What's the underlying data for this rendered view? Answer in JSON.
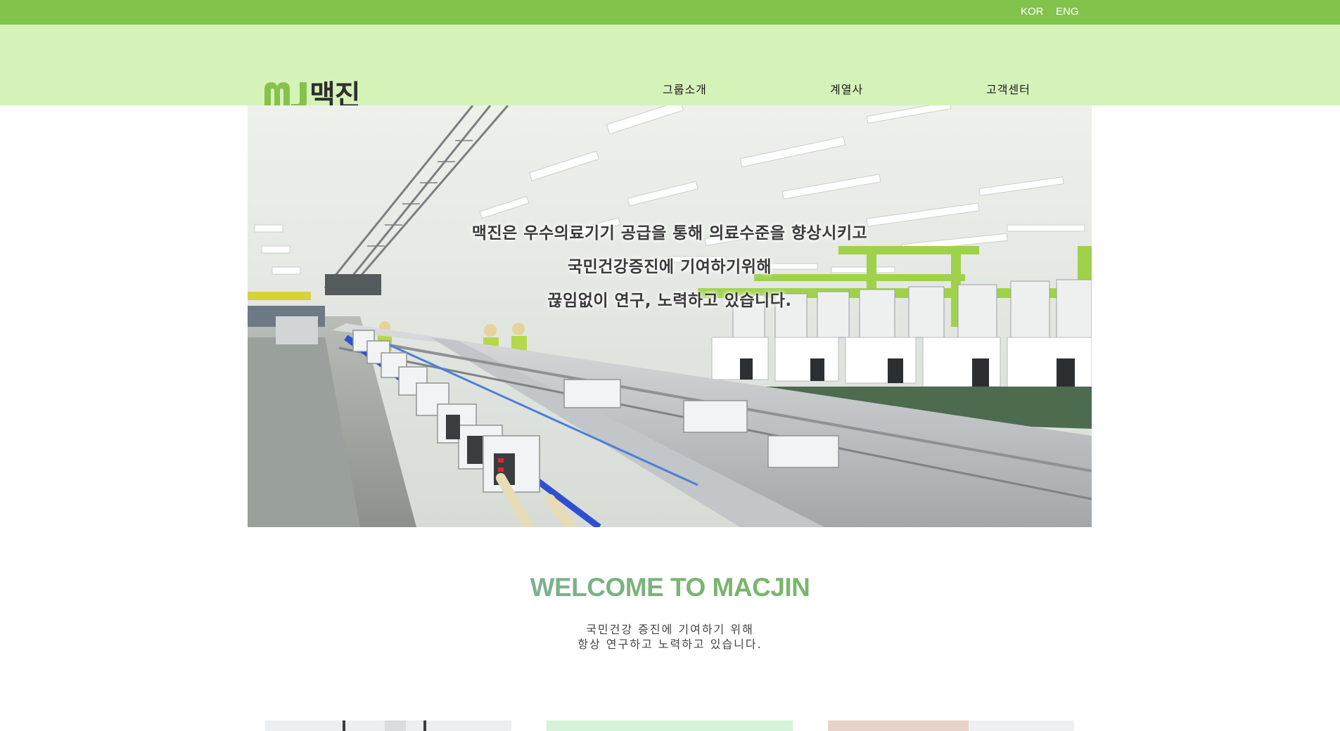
{
  "topbar": {
    "lang_kor": "KOR",
    "lang_eng": "ENG",
    "color": "#82c34c"
  },
  "header": {
    "logo_text": "맥진",
    "logo_mark": "MJ",
    "nav": [
      "그룹소개",
      "계열사",
      "고객센터"
    ],
    "color": "#d5f3b8"
  },
  "hero": {
    "lines": [
      "맥진은 우수의료기기 공급을 통해 의료수준을 향상시키고",
      "국민건강증진에 기여하기위해",
      "끊임없이 연구, 노력하고 있습니다."
    ]
  },
  "welcome": {
    "title": "WELCOME TO MACJIN",
    "sub1": "국민건강 증진에 기여하기 위해",
    "sub2": "항상 연구하고 노력하고 있습니다."
  },
  "cards": [
    "doctor-photo",
    "green-panel",
    "product-photo"
  ]
}
